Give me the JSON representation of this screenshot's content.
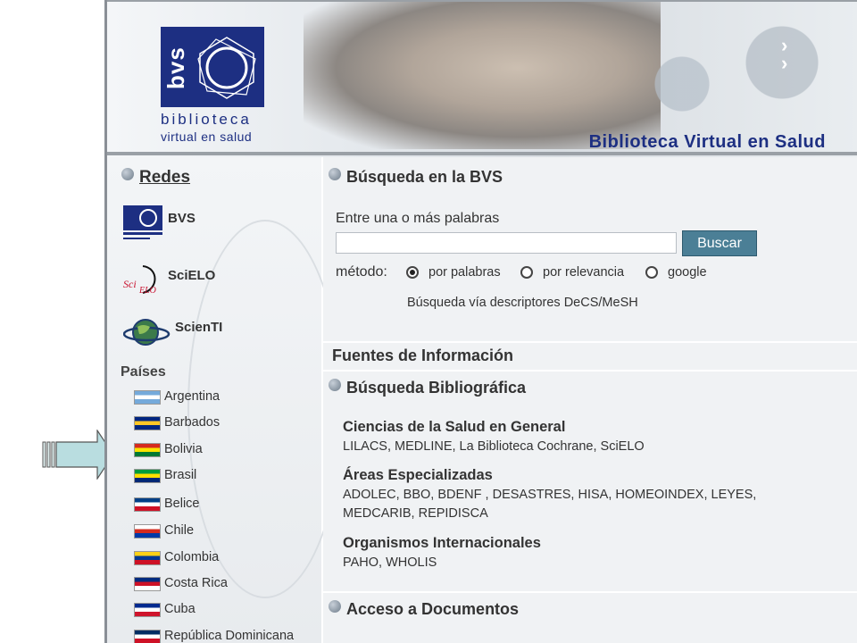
{
  "header": {
    "logo_short": "bvs",
    "logo_line1": "biblioteca",
    "logo_line2": "virtual en salud",
    "banner_title": "Biblioteca Virtual en Salud"
  },
  "sidebar": {
    "redes_title": "Redes",
    "networks": [
      {
        "label": "BVS",
        "icon": "bvs-logo-icon"
      },
      {
        "label": "SciELO",
        "icon": "scielo-logo-icon"
      },
      {
        "label": "ScienTI",
        "icon": "globe-logo-icon"
      }
    ],
    "paises_title": "Países",
    "countries": [
      {
        "name": "Argentina",
        "colors": [
          "#75aadb",
          "#ffffff",
          "#75aadb"
        ]
      },
      {
        "name": "Barbados",
        "colors": [
          "#00267f",
          "#ffc726",
          "#00267f"
        ]
      },
      {
        "name": "Bolivia",
        "colors": [
          "#d52b1e",
          "#f9e300",
          "#007934"
        ]
      },
      {
        "name": "Brasil",
        "colors": [
          "#009c3b",
          "#ffdf00",
          "#002776"
        ]
      },
      {
        "name": "Belice",
        "colors": [
          "#003f87",
          "#ffffff",
          "#ce1126"
        ]
      },
      {
        "name": "Chile",
        "colors": [
          "#ffffff",
          "#d52b1e",
          "#0039a6"
        ]
      },
      {
        "name": "Colombia",
        "colors": [
          "#fcd116",
          "#003893",
          "#ce1126"
        ]
      },
      {
        "name": "Costa Rica",
        "colors": [
          "#002b7f",
          "#ce1126",
          "#ffffff"
        ]
      },
      {
        "name": "Cuba",
        "colors": [
          "#002a8f",
          "#ffffff",
          "#cf142b"
        ]
      },
      {
        "name": "República Dominicana",
        "colors": [
          "#002d62",
          "#ffffff",
          "#ce1126"
        ]
      }
    ]
  },
  "search": {
    "title": "Búsqueda en la BVS",
    "prompt": "Entre una o más palabras",
    "input_value": "",
    "button_label": "Buscar",
    "method_label": "método:",
    "options": [
      {
        "label": "por palabras",
        "selected": true
      },
      {
        "label": "por relevancia",
        "selected": false
      },
      {
        "label": "google",
        "selected": false
      }
    ],
    "descriptor_link": "Búsqueda vía descriptores DeCS/MeSH"
  },
  "fuentes": {
    "title": "Fuentes de Información",
    "biblio_title": "Búsqueda Bibliográfica",
    "categories": [
      {
        "title": "Ciencias de la Salud en General",
        "body": "LILACS, MEDLINE, La Biblioteca Cochrane, SciELO"
      },
      {
        "title": "Áreas Especializadas",
        "body": "ADOLEC, BBO, BDENF , DESASTRES, HISA, HOMEOINDEX, LEYES, MEDCARIB, REPIDISCA"
      },
      {
        "title": "Organismos Internacionales",
        "body": "PAHO, WHOLIS"
      }
    ],
    "acceso_title": "Acceso a Documentos"
  },
  "colors": {
    "brand": "#1d2f82",
    "button": "#4b7f96",
    "arrow_fill": "#b9dde0"
  }
}
